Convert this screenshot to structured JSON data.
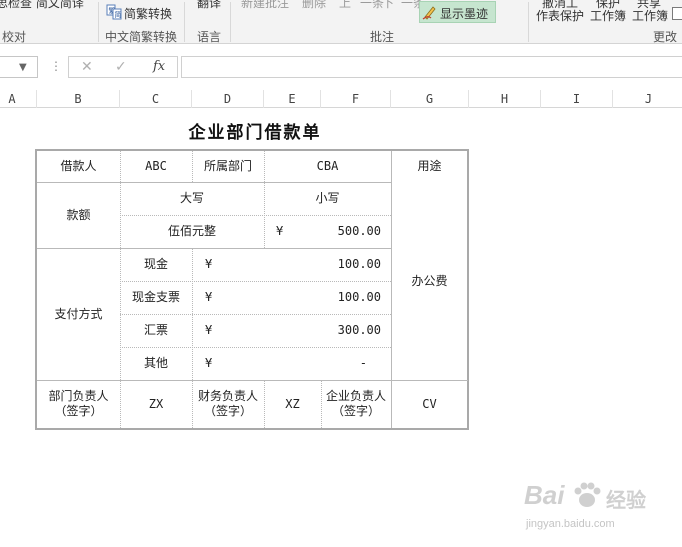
{
  "ribbon": {
    "proofing_item": "思检查 简文简译",
    "chinese_convert_button": "简繁转换",
    "translate_button": "翻译",
    "comment_items": [
      "新建批注",
      "删除",
      "上",
      "一条",
      "下",
      "一条"
    ],
    "show_ink_button": "显示墨迹",
    "protect_sheet_top": "撤消工",
    "protect_sheet": "作表保护",
    "protect_workbook_top": "保护",
    "protect_workbook": "工作簿",
    "share_workbook_top": "共享",
    "share_workbook": "工作簿",
    "groups": {
      "proofing": "校对",
      "chinese_convert": "中文简繁转换",
      "language": "语言",
      "comments": "批注",
      "changes": "更改"
    }
  },
  "formula_bar": {
    "name_box": "",
    "cancel_icon": "x-icon",
    "enter_icon": "check-icon",
    "fx_label": "fx",
    "formula": ""
  },
  "columns": [
    "A",
    "B",
    "C",
    "D",
    "E",
    "F",
    "G",
    "H",
    "I",
    "J"
  ],
  "sheet": {
    "title": "企业部门借款单",
    "labels": {
      "borrower": "借款人",
      "department": "所属部门",
      "purpose": "用途",
      "amount": "款额",
      "uppercase": "大写",
      "lowercase": "小写",
      "payment_method": "支付方式",
      "cash": "现金",
      "cash_check": "现金支票",
      "draft": "汇票",
      "other": "其他",
      "dept_head_line1": "部门负责人",
      "dept_head_line2": "（签字）",
      "finance_head_line1": "财务负责人",
      "finance_head_line2": "（签字）",
      "company_head_line1": "企业负责人",
      "company_head_line2": "（签字）"
    },
    "values": {
      "borrower": "ABC",
      "department": "CBA",
      "purpose": "办公费",
      "amount_uppercase": "伍佰元整",
      "currency_symbol": "¥",
      "amount_lowercase": "500.00",
      "cash": "100.00",
      "cash_check": "100.00",
      "draft": "300.00",
      "other": "-",
      "dept_head": "ZX",
      "finance_head": "XZ",
      "company_head": "CV"
    }
  },
  "watermark": {
    "brand": "Bai",
    "brand_cn": "经验",
    "url": "jingyan.baidu.com"
  }
}
